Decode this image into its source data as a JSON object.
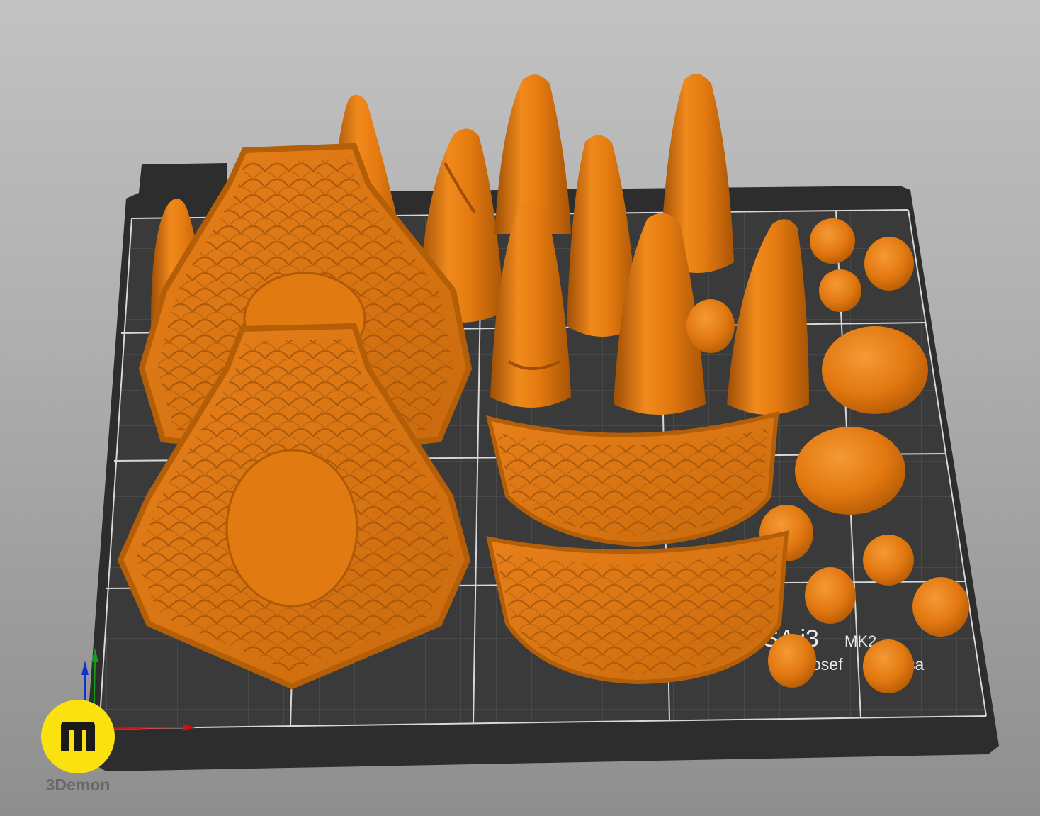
{
  "bed_label": {
    "model": "USA i3",
    "variant": "MK2",
    "maker": "osef",
    "maker_tail": "sa"
  },
  "brand": {
    "name": "3Demon",
    "badge_color": "#fbe10f"
  },
  "colors": {
    "part_orange": "#e07a10",
    "bed_surface": "#333333",
    "bed_frame": "#2d2d2d",
    "grid_line": "#ffffff",
    "axis_x": "#d01010",
    "axis_y": "#10a010",
    "axis_z": "#1030d0"
  },
  "icons": {
    "x_axis": "axis-arrow-x-icon",
    "y_axis": "axis-arrow-y-icon",
    "z_axis": "axis-arrow-z-icon",
    "brand": "3demon-logo-icon"
  }
}
